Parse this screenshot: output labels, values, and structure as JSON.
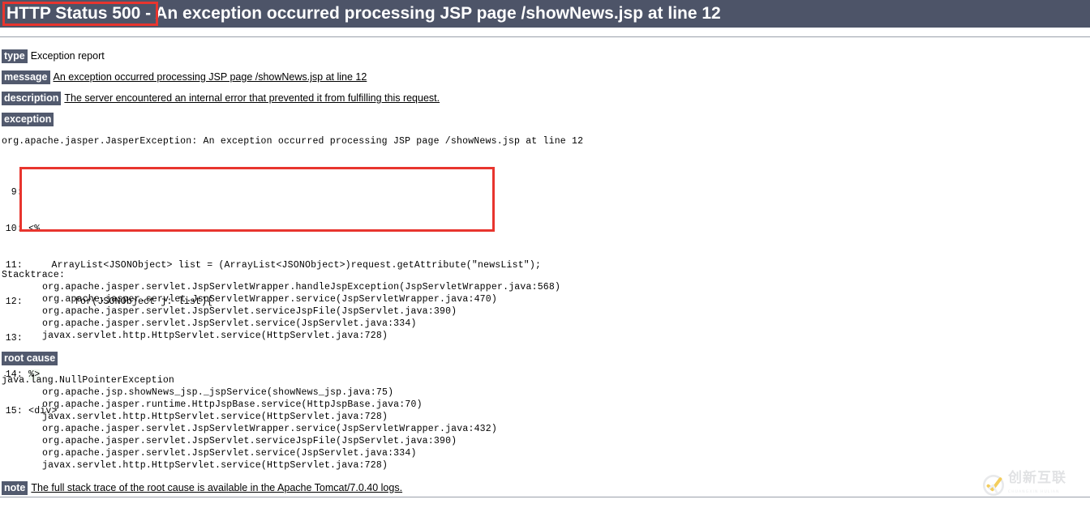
{
  "header": {
    "status_code": "HTTP Status 500",
    "separator": " - ",
    "status_message": "An exception occurred processing JSP page /showNews.jsp at line 12",
    "background_color": "#4d5468",
    "highlight_color": "#e8352e"
  },
  "sections": {
    "type": {
      "label": "type",
      "value": "Exception report"
    },
    "message": {
      "label": "message",
      "value": "An exception occurred processing JSP page /showNews.jsp at line 12"
    },
    "description": {
      "label": "description",
      "value": "The server encountered an internal error that prevented it from fulfilling this request."
    },
    "exception": {
      "label": "exception"
    },
    "root_cause": {
      "label": "root cause"
    },
    "note": {
      "label": "note",
      "value": "The full stack trace of the root cause is available in the Apache Tomcat/7.0.40 logs."
    }
  },
  "exception_line": "org.apache.jasper.JasperException: An exception occurred processing JSP page /showNews.jsp at line 12",
  "code_listing": [
    {
      "lineno": "9:",
      "src": "",
      "highlight": false
    },
    {
      "lineno": "10:",
      "src": "<%",
      "highlight": false
    },
    {
      "lineno": "11:",
      "src": "    ArrayList<JSONObject> list = (ArrayList<JSONObject>)request.getAttribute(\"newsList\");",
      "highlight": false
    },
    {
      "lineno": "12:",
      "src": "        for(JSONObject j: list){",
      "highlight": false
    },
    {
      "lineno": "13:",
      "src": "",
      "highlight": false
    },
    {
      "lineno": "14:",
      "src": "%>",
      "highlight": true
    },
    {
      "lineno": "15:",
      "src": "<div>",
      "highlight": false
    }
  ],
  "stacktrace": {
    "label": "Stacktrace:",
    "frames": [
      "org.apache.jasper.servlet.JspServletWrapper.handleJspException(JspServletWrapper.java:568)",
      "org.apache.jasper.servlet.JspServletWrapper.service(JspServletWrapper.java:470)",
      "org.apache.jasper.servlet.JspServlet.serviceJspFile(JspServlet.java:390)",
      "org.apache.jasper.servlet.JspServlet.service(JspServlet.java:334)",
      "javax.servlet.http.HttpServlet.service(HttpServlet.java:728)"
    ]
  },
  "root_cause_trace": {
    "exception": "java.lang.NullPointerException",
    "frames": [
      "org.apache.jsp.showNews_jsp._jspService(showNews_jsp.java:75)",
      "org.apache.jasper.runtime.HttpJspBase.service(HttpJspBase.java:70)",
      "javax.servlet.http.HttpServlet.service(HttpServlet.java:728)",
      "org.apache.jasper.servlet.JspServletWrapper.service(JspServletWrapper.java:432)",
      "org.apache.jasper.servlet.JspServlet.serviceJspFile(JspServlet.java:390)",
      "org.apache.jasper.servlet.JspServlet.service(JspServlet.java:334)",
      "javax.servlet.http.HttpServlet.service(HttpServlet.java:728)"
    ]
  },
  "watermark": {
    "text": "创新互联",
    "subtext": "CHUANGXIN HULIAN",
    "logo_icon": "circle-check-logo-icon"
  }
}
